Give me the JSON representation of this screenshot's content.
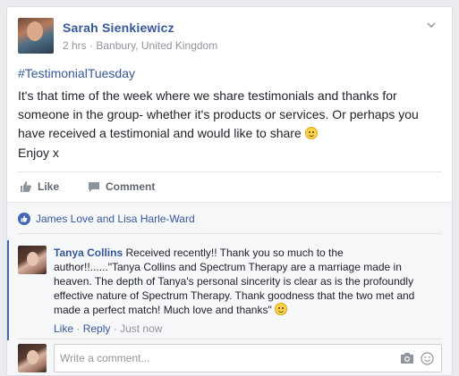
{
  "post": {
    "author": "Sarah Sienkiewicz",
    "time": "2 hrs",
    "separator": "·",
    "location": "Banbury, United Kingdom",
    "hashtag": "#TestimonialTuesday",
    "body": "It's that time of the week where we share testimonials and thanks for someone in the group- whether it's products or services. Or perhaps you have received a testimonial and would like to share",
    "closing": "Enjoy x"
  },
  "actions": {
    "like_label": "Like",
    "comment_label": "Comment"
  },
  "reactions": {
    "likers": "James Love and Lisa Harle-Ward"
  },
  "comment": {
    "author": "Tanya Collins",
    "text": "Received recently!! Thank you so much to the author!!......\"Tanya Collins and Spectrum Therapy are a marriage made in heaven. The depth of Tanya's personal sincerity is clear as is the profoundly effective nature of Spectrum Therapy. Thank goodness that the two met and made a perfect match! Much love and thanks\"",
    "like_link": "Like",
    "reply_link": "Reply",
    "time": "Just now",
    "sep": "·"
  },
  "composer": {
    "placeholder": "Write a comment..."
  },
  "colors": {
    "link": "#365899",
    "meta": "#90949c",
    "accent": "#4267b2"
  },
  "icons": {
    "chevron": "chevron-down-icon",
    "like": "thumbs-up-icon",
    "comment": "speech-bubble-icon",
    "camera": "camera-icon",
    "emoji": "smiley-icon"
  }
}
